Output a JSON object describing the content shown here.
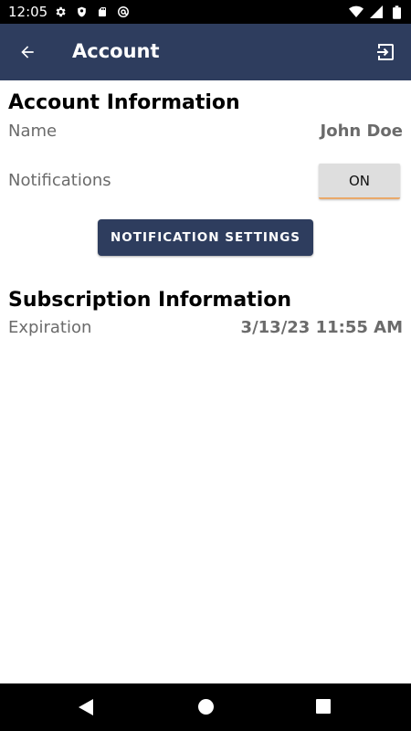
{
  "status_bar": {
    "time": "12:05",
    "icons_left": [
      "gear-icon",
      "shield-icon",
      "sd-card-icon",
      "at-sign-icon"
    ],
    "icons_right": [
      "wifi-icon",
      "signal-icon",
      "battery-icon"
    ]
  },
  "app_bar": {
    "title": "Account",
    "back_icon": "arrow-left-icon",
    "exit_icon": "exit-icon",
    "color": "#2e3d5e"
  },
  "account": {
    "section_title": "Account Information",
    "name_label": "Name",
    "name_value": "John Doe",
    "notifications_label": "Notifications",
    "notifications_toggle": "ON",
    "notification_settings_button": "NOTIFICATION SETTINGS"
  },
  "subscription": {
    "section_title": "Subscription Information",
    "expiration_label": "Expiration",
    "expiration_value": "3/13/23 11:55 AM"
  },
  "colors": {
    "primary": "#2e3d5e",
    "toggle_accent": "#e9a96a"
  }
}
